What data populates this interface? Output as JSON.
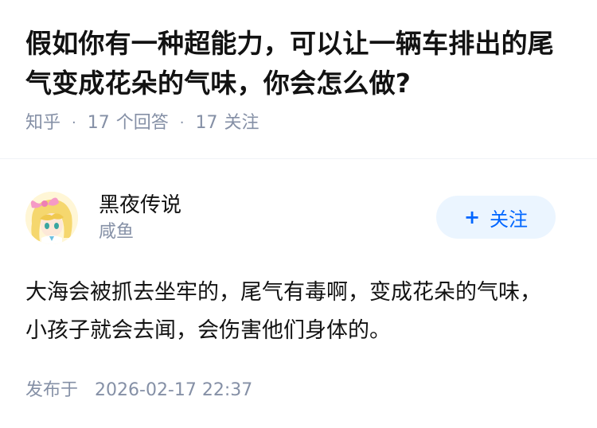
{
  "question": {
    "title": "假如你有一种超能力，可以让一辆车排出的尾气变成花朵的气味，你会怎么做?",
    "source": "知乎",
    "answer_count": "17",
    "answer_label": "个回答",
    "follower_count": "17",
    "follower_label": "关注",
    "separator": "·"
  },
  "answer": {
    "author": {
      "name": "黑夜传说",
      "headline": "咸鱼",
      "avatar_icon": "anime-girl-avatar-icon"
    },
    "follow_label": "关注",
    "content": "大海会被抓去坐牢的，尾气有毒啊，变成花朵的气味，小孩子就会去闻，会伤害他们身体的。",
    "publish_label": "发布于",
    "publish_time": "2026-02-17 22:37"
  },
  "colors": {
    "accent": "#0066ff",
    "accent_bg": "#ebf5ff",
    "meta_text": "#8590a6",
    "body_text": "#121212"
  }
}
